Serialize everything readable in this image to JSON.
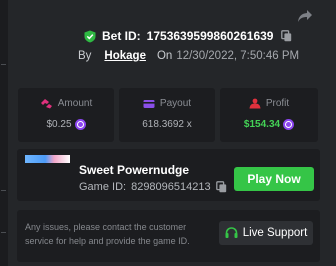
{
  "bet": {
    "label": "Bet ID:",
    "id": "1753639599860261639",
    "by_label": "By",
    "user": "Hokage",
    "on_label": "On",
    "date": "12/30/2022, 7:50:46 PM"
  },
  "stats": {
    "amount": {
      "label": "Amount",
      "value": "$0.25"
    },
    "payout": {
      "label": "Payout",
      "value": "618.3692 x"
    },
    "profit": {
      "label": "Profit",
      "value": "$154.34"
    }
  },
  "game": {
    "name": "Sweet Powernudge",
    "id_label": "Game ID:",
    "id": "8298096514213",
    "play_label": "Play Now"
  },
  "support": {
    "text": "Any issues, please contact the customer service for help and provide the game ID.",
    "button_label": "Live Support"
  },
  "colors": {
    "accent_green": "#35c547",
    "profit_green": "#44d256",
    "coin_purple": "#8b45f0",
    "amount_pink": "#e0317d",
    "payout_purple": "#8a4fe8",
    "profit_red": "#e0313d"
  }
}
